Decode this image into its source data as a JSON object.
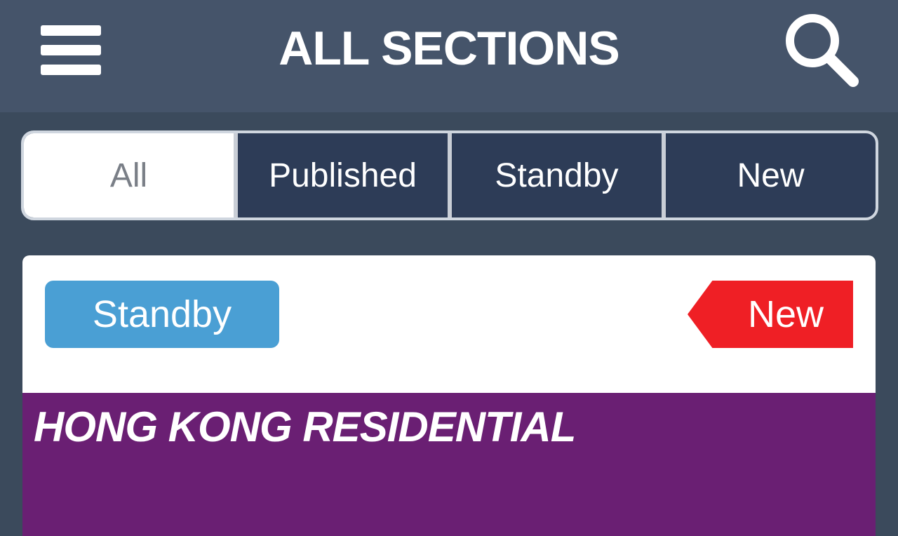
{
  "header": {
    "title": "ALL SECTIONS",
    "menu_icon": "hamburger-icon",
    "search_icon": "search-icon"
  },
  "filter_tabs": [
    {
      "label": "All",
      "active": true
    },
    {
      "label": "Published",
      "active": false
    },
    {
      "label": "Standby",
      "active": false
    },
    {
      "label": "New",
      "active": false
    }
  ],
  "card": {
    "status": "Standby",
    "flag": "New",
    "section": "HONG KONG RESIDENTIAL",
    "subtitle": ""
  },
  "colors": {
    "header_bg": "#45546a",
    "page_bg": "#3b4a5c",
    "segment_bg": "#2d3c57",
    "status_badge": "#4a9fd4",
    "new_tag": "#ef1f25",
    "section_band": "#6a1f73"
  }
}
